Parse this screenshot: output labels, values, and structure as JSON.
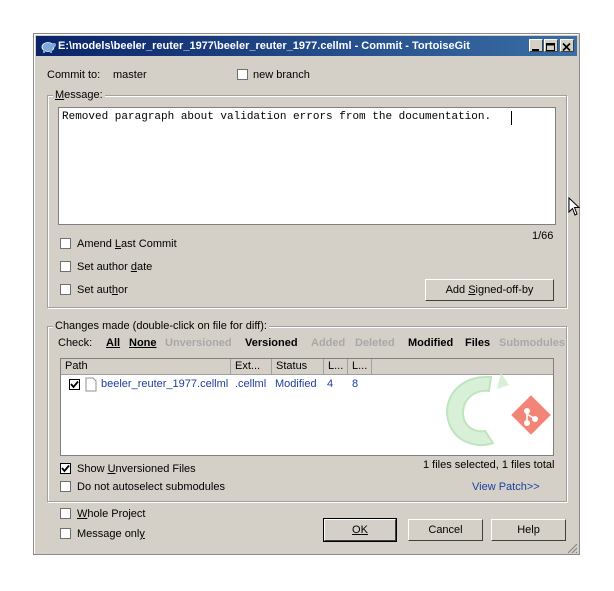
{
  "window": {
    "title": "E:\\models\\beeler_reuter_1977\\beeler_reuter_1977.cellml - Commit - TortoiseGit"
  },
  "commit_to": {
    "label": "Commit to:",
    "branch": "master"
  },
  "new_branch": {
    "label": "new branch",
    "checked": false
  },
  "message": {
    "group_label": "Message:",
    "text": "Removed paragraph about validation errors from the documentation.",
    "counter": "1/66"
  },
  "options": {
    "amend": "Amend Last Commit",
    "author_date": "Set author date",
    "author": "Set author",
    "signoff_button": "Add Signed-off-by"
  },
  "changes": {
    "group_label": "Changes made (double-click on file for diff):",
    "check_label": "Check:",
    "filters": [
      {
        "label": "All",
        "enabled": true
      },
      {
        "label": "None",
        "enabled": true
      },
      {
        "label": "Unversioned",
        "enabled": false
      },
      {
        "label": "Versioned",
        "enabled": true
      },
      {
        "label": "Added",
        "enabled": false
      },
      {
        "label": "Deleted",
        "enabled": false
      },
      {
        "label": "Modified",
        "enabled": true
      },
      {
        "label": "Files",
        "enabled": true
      },
      {
        "label": "Submodules",
        "enabled": false
      }
    ],
    "columns": [
      "Path",
      "Ext...",
      "Status",
      "L...",
      "L..."
    ],
    "rows": [
      {
        "checked": true,
        "path": "beeler_reuter_1977.cellml",
        "ext": ".cellml",
        "status": "Modified",
        "added": "4",
        "deleted": "8"
      }
    ],
    "show_unversioned": {
      "label": "Show Unversioned Files",
      "checked": true
    },
    "no_autoselect": {
      "label": "Do not autoselect submodules",
      "checked": false
    },
    "selection_summary": "1 files selected, 1 files total",
    "view_patch": "View Patch>>"
  },
  "bottom": {
    "whole_project": "Whole Project",
    "message_only": "Message only",
    "ok": "OK",
    "cancel": "Cancel",
    "help": "Help"
  },
  "colors": {
    "titlebar": "#0a246a",
    "link": "#1c3fa0",
    "dialog": "#d4d0c8"
  }
}
